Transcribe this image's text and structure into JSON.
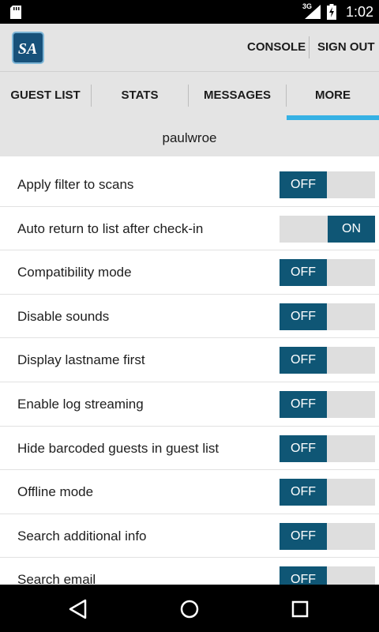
{
  "status_bar": {
    "network": "3G",
    "time": "1:02"
  },
  "app_bar": {
    "logo_text": "SA",
    "console_label": "CONSOLE",
    "signout_label": "SIGN OUT"
  },
  "tabs": [
    {
      "label": "GUEST LIST"
    },
    {
      "label": "STATS"
    },
    {
      "label": "MESSAGES"
    },
    {
      "label": "MORE",
      "active": true
    }
  ],
  "colors": {
    "toggle_active": "#0f5675",
    "tab_indicator": "#36b1e4",
    "bar_background": "#e4e4e4"
  },
  "user": {
    "username": "paulwroe"
  },
  "settings": [
    {
      "label": "Apply filter to scans",
      "state": "OFF"
    },
    {
      "label": "Auto return to list after check-in",
      "state": "ON"
    },
    {
      "label": "Compatibility mode",
      "state": "OFF"
    },
    {
      "label": "Disable sounds",
      "state": "OFF"
    },
    {
      "label": "Display lastname first",
      "state": "OFF"
    },
    {
      "label": "Enable log streaming",
      "state": "OFF"
    },
    {
      "label": "Hide barcoded guests in guest list",
      "state": "OFF"
    },
    {
      "label": "Offline mode",
      "state": "OFF"
    },
    {
      "label": "Search additional info",
      "state": "OFF"
    },
    {
      "label": "Search email",
      "state": "OFF"
    }
  ],
  "nav": {
    "icons": [
      "back-icon",
      "home-icon",
      "recents-icon"
    ]
  }
}
